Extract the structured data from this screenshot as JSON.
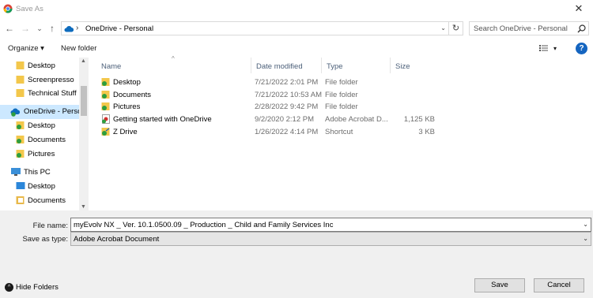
{
  "window": {
    "title": "Save As",
    "close_glyph": "✕",
    "icon": "chrome-app-icon"
  },
  "address_bar": {
    "back_glyph": "←",
    "forward_glyph": "→",
    "recent_glyph": "⌄",
    "up_glyph": "↑",
    "location_icon": "onedrive-cloud-icon",
    "separator": "›",
    "path": "OneDrive - Personal",
    "dropdown_glyph": "⌄",
    "refresh_glyph": "↻"
  },
  "search": {
    "placeholder": "Search OneDrive - Personal",
    "icon": "search-icon"
  },
  "toolbar": {
    "organize_label": "Organize ▾",
    "new_folder_label": "New folder",
    "views_dropdown": "▾",
    "help_label": "?"
  },
  "nav_pane": {
    "items": [
      {
        "label": "Desktop",
        "icon": "folder-icon"
      },
      {
        "label": "Screenpresso",
        "icon": "folder-icon"
      },
      {
        "label": "Technical Stuff",
        "icon": "folder-icon"
      },
      {
        "label": "OneDrive - Persor",
        "icon": "onedrive-cloud-icon",
        "selected": true
      },
      {
        "label": "Desktop",
        "icon": "folder-synced-icon"
      },
      {
        "label": "Documents",
        "icon": "folder-synced-icon"
      },
      {
        "label": "Pictures",
        "icon": "folder-synced-icon"
      },
      {
        "label": "This PC",
        "icon": "computer-icon"
      },
      {
        "label": "Desktop",
        "icon": "desktop-folder-icon"
      },
      {
        "label": "Documents",
        "icon": "documents-folder-icon"
      }
    ],
    "scroll_up": "▲",
    "scroll_down": "▼"
  },
  "file_list": {
    "sort_indicator": "^",
    "columns": [
      "Name",
      "Date modified",
      "Type",
      "Size"
    ],
    "rows": [
      {
        "name": "Desktop",
        "date": "7/21/2022 2:01 PM",
        "type": "File folder",
        "size": "",
        "icon": "folder-synced-icon"
      },
      {
        "name": "Documents",
        "date": "7/21/2022 10:53 AM",
        "type": "File folder",
        "size": "",
        "icon": "folder-synced-icon"
      },
      {
        "name": "Pictures",
        "date": "2/28/2022 9:42 PM",
        "type": "File folder",
        "size": "",
        "icon": "folder-synced-icon"
      },
      {
        "name": "Getting started with OneDrive",
        "date": "9/2/2020 2:12 PM",
        "type": "Adobe Acrobat D...",
        "size": "1,125 KB",
        "icon": "pdf-file-icon"
      },
      {
        "name": "Z Drive",
        "date": "1/26/2022 4:14 PM",
        "type": "Shortcut",
        "size": "3 KB",
        "icon": "shortcut-folder-icon"
      }
    ]
  },
  "save_form": {
    "file_name_label": "File name:",
    "file_name_value": "myEvolv NX _ Ver. 10.1.0500.09 _ Production _ Child and Family Services Inc",
    "save_type_label": "Save as type:",
    "save_type_value": "Adobe Acrobat Document",
    "dropdown_glyph": "⌄"
  },
  "footer": {
    "hide_folders_label": "Hide Folders",
    "hide_glyph": "^",
    "save_label": "Save",
    "cancel_label": "Cancel"
  },
  "colors": {
    "selection": "#cce8ff",
    "folder": "#f3c74b",
    "sync_green": "#2e9e3e",
    "onedrive": "#0f6cbd",
    "header_text": "#4c607a"
  }
}
